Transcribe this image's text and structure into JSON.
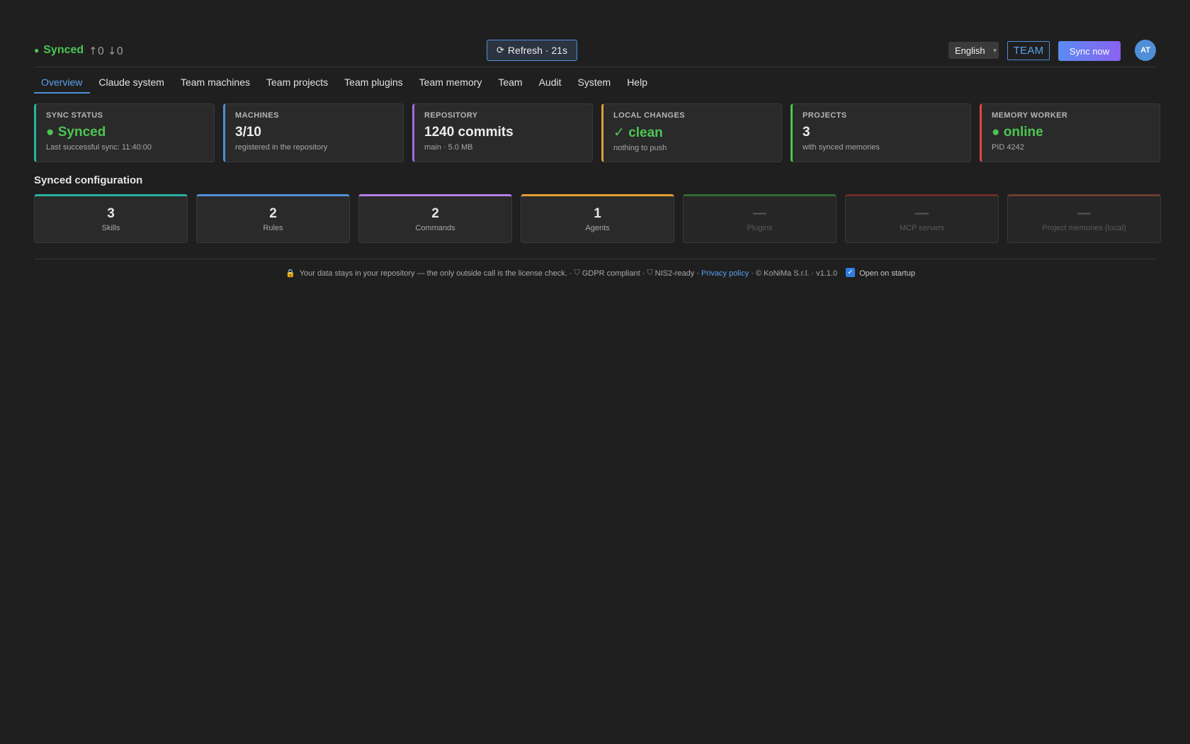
{
  "header": {
    "sync_status": "Synced",
    "sync_counts": "↑0 ↓0",
    "refresh_label": "Refresh · 21s",
    "language": "English",
    "plan_badge": "TEAM",
    "sync_now_label": "Sync now",
    "avatar_initials": "AT"
  },
  "tabs": [
    {
      "label": "Overview",
      "active": true
    },
    {
      "label": "Claude system"
    },
    {
      "label": "Team machines"
    },
    {
      "label": "Team projects"
    },
    {
      "label": "Team plugins"
    },
    {
      "label": "Team memory"
    },
    {
      "label": "Team"
    },
    {
      "label": "Audit"
    },
    {
      "label": "System"
    },
    {
      "label": "Help"
    }
  ],
  "stats": [
    {
      "label": "SYNC STATUS",
      "value": "● Synced",
      "sub": "Last successful sync: 11:40:00",
      "color": "#2bb3a0",
      "green": true
    },
    {
      "label": "MACHINES",
      "value": "3/10",
      "sub": "registered in the repository",
      "color": "#4f8fd8"
    },
    {
      "label": "REPOSITORY",
      "value": "1240 commits",
      "sub": "main · 5.0 MB",
      "color": "#a06be0"
    },
    {
      "label": "LOCAL CHANGES",
      "value": "✓ clean",
      "sub": "nothing to push",
      "color": "#e0a030",
      "green": true
    },
    {
      "label": "PROJECTS",
      "value": "3",
      "sub": "with synced memories",
      "color": "#4cc552"
    },
    {
      "label": "MEMORY WORKER",
      "value": "● online",
      "sub": "PID 4242",
      "color": "#e04848",
      "green": true
    }
  ],
  "section_title": "Synced configuration",
  "configs": [
    {
      "num": "3",
      "name": "Skills",
      "color": "#2bb3a0"
    },
    {
      "num": "2",
      "name": "Rules",
      "color": "#4f8fd8"
    },
    {
      "num": "2",
      "name": "Commands",
      "color": "#b67ee8"
    },
    {
      "num": "1",
      "name": "Agents",
      "color": "#e0a030"
    },
    {
      "num": "—",
      "name": "Plugins",
      "color": "#2f6a34",
      "dim": true
    },
    {
      "num": "—",
      "name": "MCP servers",
      "color": "#6a2e2a",
      "dim": true
    },
    {
      "num": "—",
      "name": "Project memories (local)",
      "color": "#6a3f30",
      "dim": true
    }
  ],
  "footer": {
    "privacy_note": "Your data stays in your repository — the only outside call is the license check. ·",
    "gdpr": "GDPR compliant ·",
    "nis2": "NIS2-ready ·",
    "privacy_link": "Privacy policy",
    "copyright": "· © KoNiMa S.r.l. · v1.1.0",
    "startup_label": "Open on startup"
  }
}
